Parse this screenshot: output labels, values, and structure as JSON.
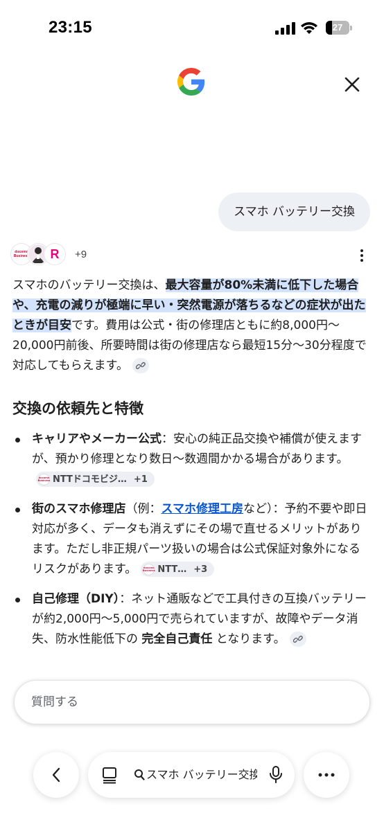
{
  "status_bar": {
    "time": "23:15",
    "battery_level": "27",
    "battery_fraction": 0.27,
    "icons": [
      "cellular-signal-icon",
      "wifi-icon",
      "battery-icon"
    ]
  },
  "header": {
    "logo": "google-g-logo",
    "close_icon": "close-icon"
  },
  "query": "スマホ バッテリー交換",
  "sources": {
    "icons": [
      "docomo-business-icon",
      "person-icon",
      "rakuten-icon"
    ],
    "icon_docomo_text": "docomo Business",
    "icon_rakuten_text": "R",
    "more_count": "+9"
  },
  "answer": {
    "intro_start": "スマホのバッテリー交換は、",
    "intro_highlight": "最大容量が80%未満に低下した場合や、充電の減りが極端に早い・突然電源が落ちるなどの症状が出たときが目安",
    "intro_end": "です。費用は公式・街の修理店ともに約8,000円〜20,000円前後、所要時間は街の修理店なら最短15分〜30分程度で対応してもらえます。"
  },
  "section": {
    "title": "交換の依頼先と特徴",
    "items": [
      {
        "title": "キャリアやメーカー公式",
        "text": "：安心の純正品交換や補償が使えますが、預かり修理となり数日〜数週間かかる場合があります。",
        "chip_label": "NTTドコモビジ…",
        "chip_count": "+1"
      },
      {
        "title": "街のスマホ修理店",
        "paren_open": "（例：",
        "link": "スマホ修理工房",
        "paren_close": "など）",
        "text": "：予約不要や即日対応が多く、データも消えずにその場で直せるメリットがあります。ただし非正規パーツ扱いの場合は公式保証対象外になるリスクがあります。",
        "chip_label": "NTT…",
        "chip_count": "+3"
      },
      {
        "title": "自己修理（DIY）",
        "text": "：ネット通販などで工具付きの互換バッテリーが約2,000円〜5,000円で売られていますが、故障やデータ消失、防水性能低下の ",
        "bold2": "完全自己責任",
        "text2": " となります。"
      }
    ]
  },
  "ask": {
    "placeholder": "質問する"
  },
  "bottom_bar": {
    "url_text": "スマホ バッテリー交換",
    "icons": [
      "back-icon",
      "tabs-icon",
      "search-icon",
      "mic-icon",
      "more-icon"
    ]
  },
  "colors": {
    "highlight": "#d3e3fd",
    "link": "#0b57d0",
    "bubble": "#edf0f5",
    "chip": "#eceff3"
  }
}
